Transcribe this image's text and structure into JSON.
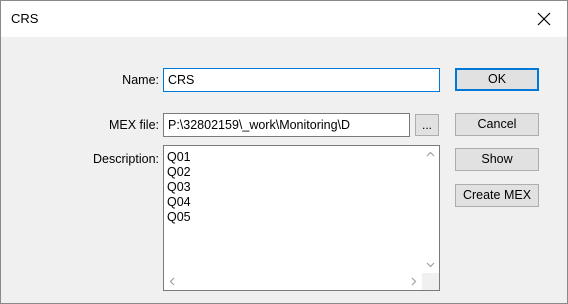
{
  "window": {
    "title": "CRS",
    "close_icon": "close-icon"
  },
  "form": {
    "name_label": "Name:",
    "name_value": "CRS",
    "mex_label": "MEX file:",
    "mex_value": "P:\\32802159\\_work\\Monitoring\\D",
    "browse_label": "...",
    "description_label": "Description:",
    "description_lines": [
      "Q01",
      "Q02",
      "Q03",
      "Q04",
      "Q05"
    ]
  },
  "buttons": {
    "ok": "OK",
    "cancel": "Cancel",
    "show": "Show",
    "create_mex": "Create MEX"
  },
  "colors": {
    "focus_border": "#0078d7",
    "dialog_bg": "#f0f0f0"
  }
}
